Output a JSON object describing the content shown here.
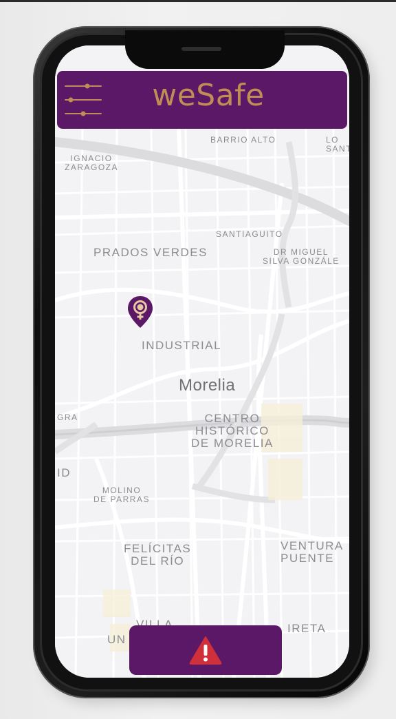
{
  "app": {
    "title": "weSafe",
    "brand_color": "#5b1866",
    "title_color": "#c18d57"
  },
  "header": {
    "menu_icon": "sliders-menu-icon"
  },
  "map": {
    "city": "Morelia",
    "labels": {
      "barrio_alto": "BARRIO ALTO",
      "lo_sant": "LO\nSANT",
      "ignacio_zaragoza": "IGNACIO\nZARAGOZA",
      "santiaguito": "SANTIAGUITO",
      "prados_verdes": "PRADOS VERDES",
      "dr_miguel": "DR MIGUEL\nSILVA GONZÁLE",
      "industrial": "INDUSTRIAL",
      "gra": "GRA",
      "centro_historico": "CENTRO\nHISTÓRICO\nDE MORELIA",
      "id": "ID",
      "molino_de_parras": "MOLINO\nDE PARRAS",
      "felicitas_del_rio": "FELÍCITAS\nDEL RÍO",
      "ventura_puente": "VENTURA\nPUENTE",
      "villa": "VILLA",
      "un": "UN",
      "ireta": "IRETA"
    },
    "marker": {
      "icon": "female-location-pin-icon",
      "color": "#5b1866"
    }
  },
  "alert": {
    "icon": "warning-triangle-icon",
    "icon_color": "#d0303a"
  }
}
